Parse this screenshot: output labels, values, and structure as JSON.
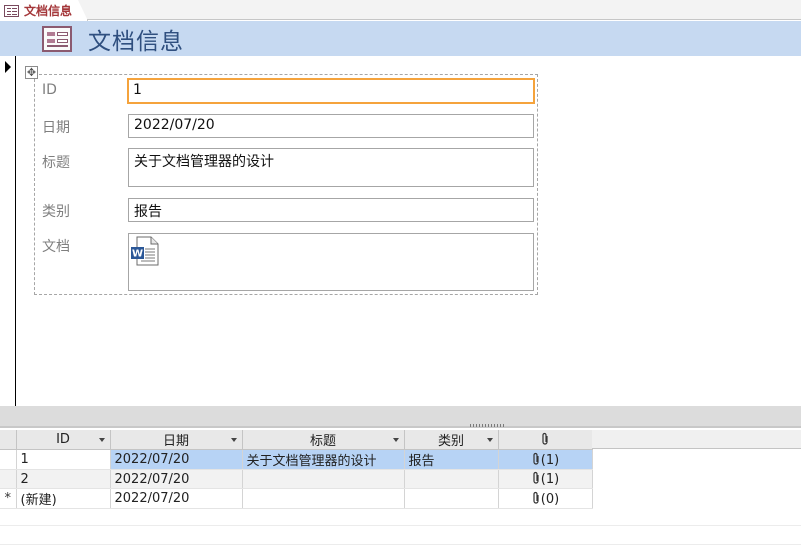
{
  "tab": {
    "label": "文档信息",
    "icon": "form-icon"
  },
  "header": {
    "title": "文档信息",
    "icon": "form-icon"
  },
  "form": {
    "fields": [
      {
        "label": "ID",
        "value": "1"
      },
      {
        "label": "日期",
        "value": "2022/07/20"
      },
      {
        "label": "标题",
        "value": "关于文档管理器的设计"
      },
      {
        "label": "类别",
        "value": "报告"
      },
      {
        "label": "文档",
        "value": "",
        "attachment_icon": "word-document-icon"
      }
    ]
  },
  "datasheet": {
    "columns": [
      "ID",
      "日期",
      "标题",
      "类别"
    ],
    "attachment_column_icon": "paperclip-icon",
    "rows": [
      {
        "id": "1",
        "date": "2022/07/20",
        "title": "关于文档管理器的设计",
        "category": "报告",
        "attachments": "(1)"
      },
      {
        "id": "2",
        "date": "2022/07/20",
        "title": "",
        "category": "",
        "attachments": "(1)"
      },
      {
        "id": "(新建)",
        "date": "2022/07/20",
        "title": "",
        "category": "",
        "attachments": "(0)",
        "selector": "*"
      }
    ]
  },
  "colors": {
    "header_bg": "#c6d9f1",
    "tab_text": "#a4373a",
    "focus_border": "#f5a33c",
    "selected_row": "#b7d3f5"
  }
}
